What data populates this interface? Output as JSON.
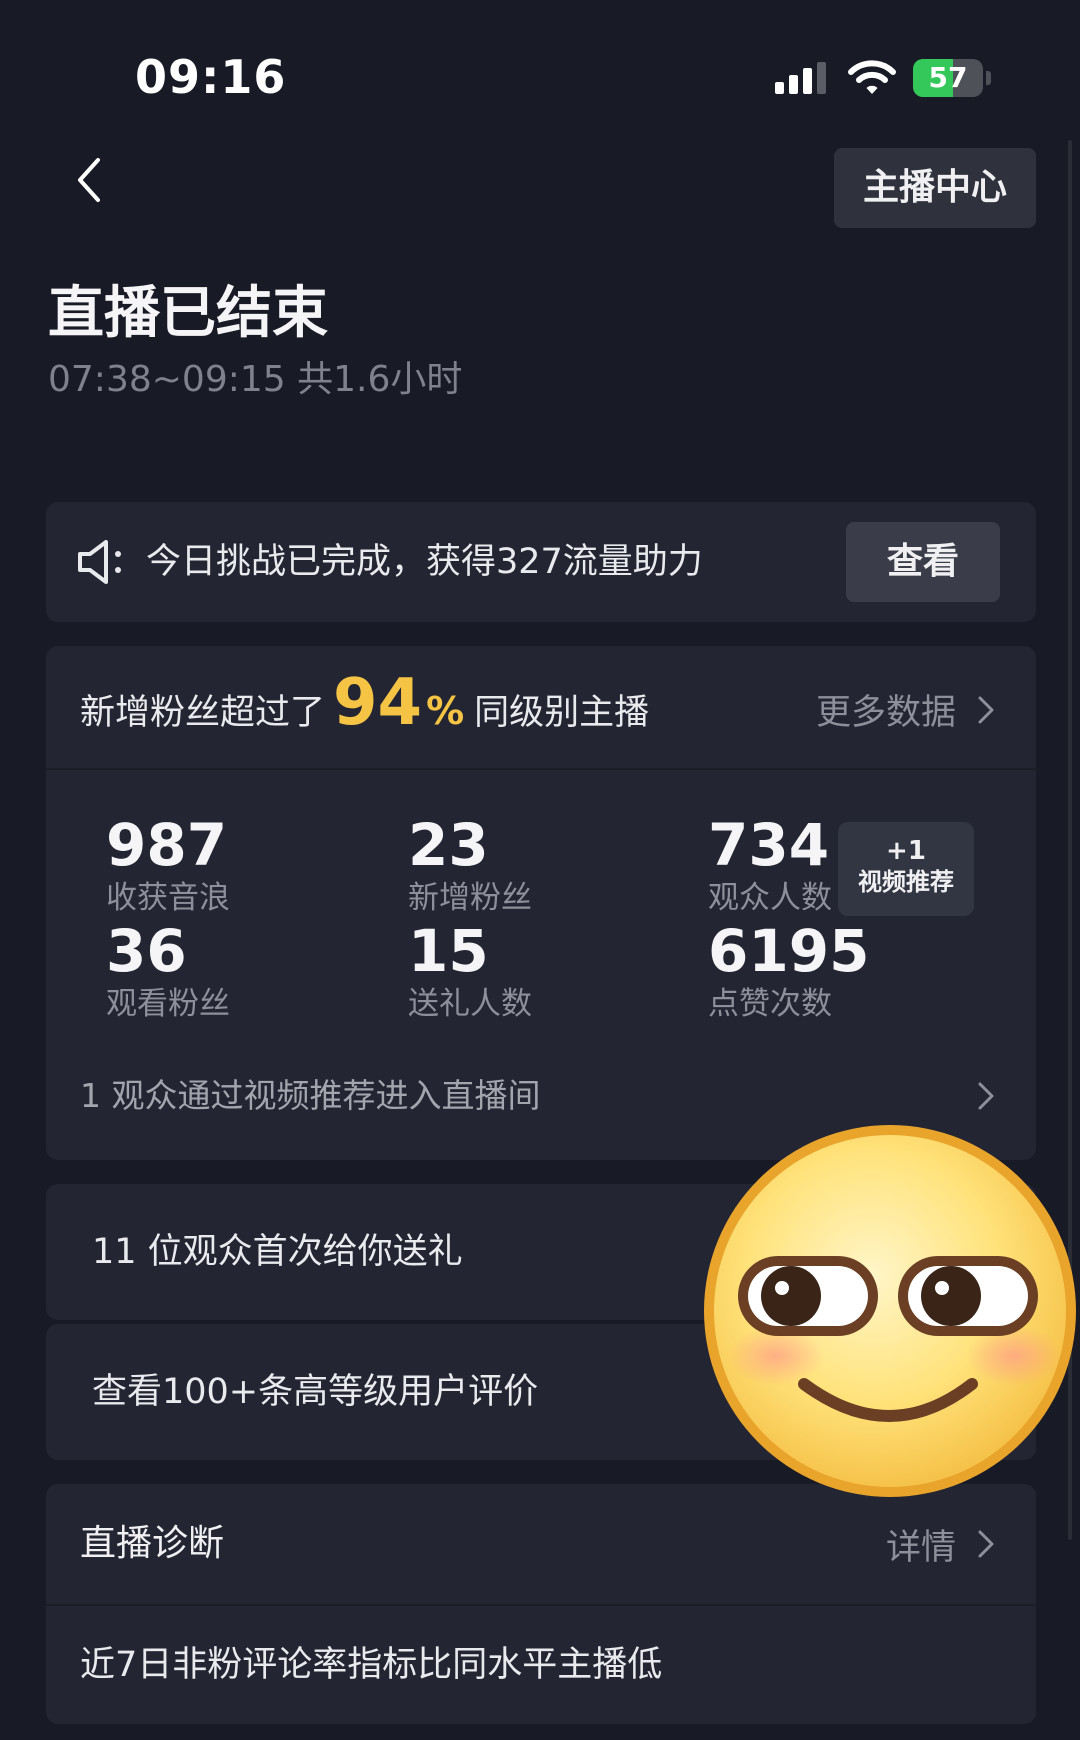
{
  "status_bar": {
    "time": "09:16",
    "battery_label": "57",
    "battery_level": 0.57,
    "battery_color": "#34c759"
  },
  "header": {
    "back_icon": "chevron-left-icon",
    "anchor_center_label": "主播中心"
  },
  "summary": {
    "title": "直播已结束",
    "subtitle": "07:38~09:15 共1.6小时"
  },
  "notice": {
    "icon": "speaker-icon",
    "text": "今日挑战已完成，获得327流量助力",
    "button_label": "查看"
  },
  "stats": {
    "headline_prefix": "新增粉丝超过了",
    "headline_percent": "94",
    "headline_percent_symbol": "%",
    "headline_suffix": "同级别主播",
    "highlight_color": "#f5c445",
    "more_label": "更多数据",
    "items": [
      {
        "value": "987",
        "label": "收获音浪"
      },
      {
        "value": "23",
        "label": "新增粉丝"
      },
      {
        "value": "734",
        "label": "观众人数"
      },
      {
        "value": "36",
        "label": "观看粉丝"
      },
      {
        "value": "15",
        "label": "送礼人数"
      },
      {
        "value": "6195",
        "label": "点赞次数"
      }
    ],
    "badge": {
      "plus": "+1",
      "label": "视频推荐"
    },
    "footer": "1 观众通过视频推荐进入直播间"
  },
  "gift_row": {
    "text": "11 位观众首次给你送礼"
  },
  "reviews_row": {
    "text": "查看100+条高等级用户评价"
  },
  "diagnosis": {
    "title": "直播诊断",
    "details_label": "详情",
    "item": "近7日非粉评论率指标比同水平主播低"
  },
  "overlay": {
    "icon": "smirk-emoji-icon"
  }
}
